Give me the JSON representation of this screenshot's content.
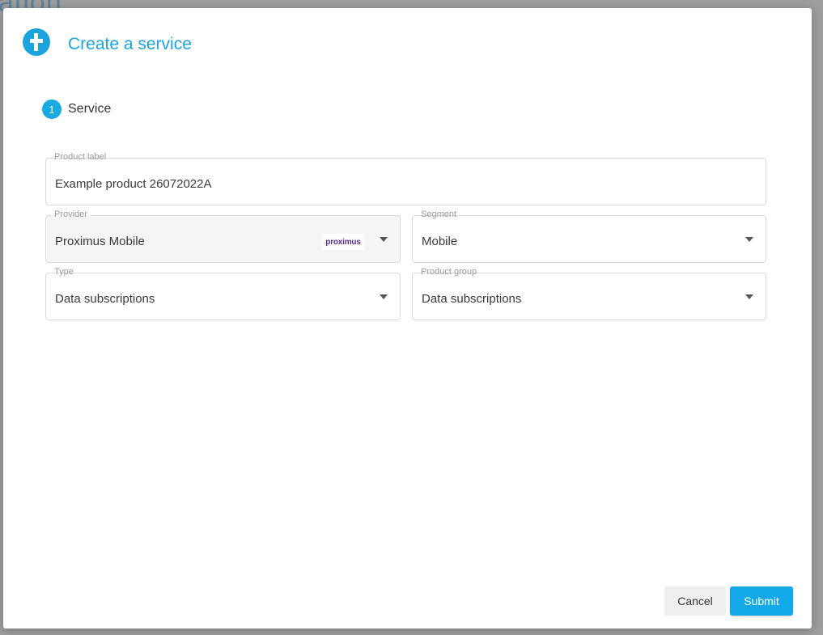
{
  "dialog": {
    "title": "Create a service",
    "step": {
      "number": "1",
      "label": "Service"
    }
  },
  "form": {
    "product_label": {
      "label": "Product label",
      "value": "Example product 26072022A"
    },
    "provider": {
      "label": "Provider",
      "value": "Proximus Mobile",
      "logo_text": "proximus"
    },
    "segment": {
      "label": "Segment",
      "value": "Mobile"
    },
    "type": {
      "label": "Type",
      "value": "Data subscriptions"
    },
    "product_group": {
      "label": "Product group",
      "value": "Data subscriptions"
    }
  },
  "actions": {
    "cancel_label": "Cancel",
    "submit_label": "Submit"
  },
  "icons": {
    "app_logo": "brand-logo-icon",
    "dropdown": "caret-down-icon"
  },
  "colors": {
    "accent": "#1aa3dc",
    "submit": "#13a8e8",
    "provider_brand": "#5c2d91"
  }
}
